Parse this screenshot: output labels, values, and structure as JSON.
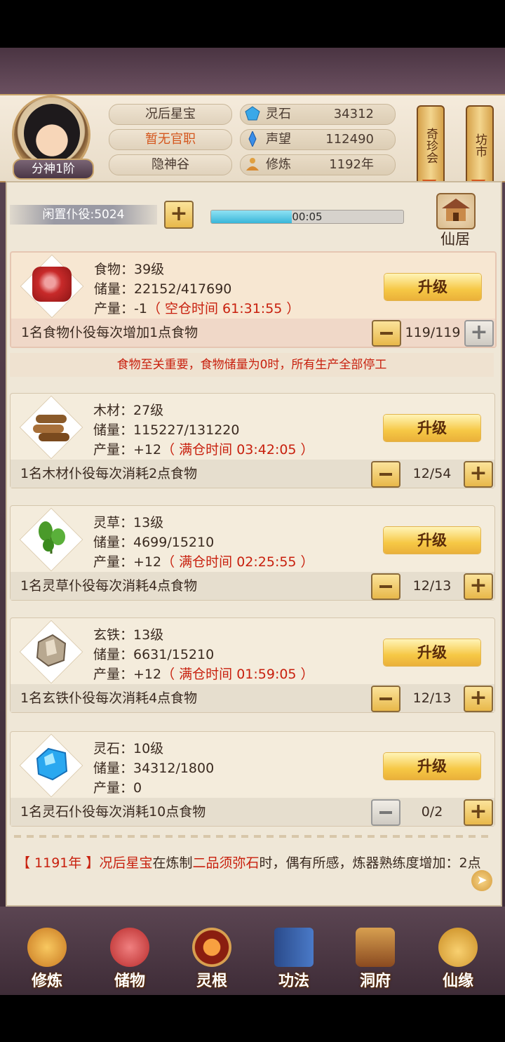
{
  "header": {
    "player_name": "况后星宝",
    "official_rank": "暂无官职",
    "location": "隐神谷",
    "realm_badge": "分神1阶",
    "resources": [
      {
        "icon": "spirit-stone-icon",
        "label": "灵石",
        "value": "34312"
      },
      {
        "icon": "reputation-icon",
        "label": "声望",
        "value": "112490"
      },
      {
        "icon": "cultivation-icon",
        "label": "修炼",
        "value": "1192年"
      }
    ],
    "scroll_buttons": [
      "奇珍会",
      "坊市"
    ]
  },
  "idle": {
    "label": "闲置仆役:5024",
    "timer": "00:05",
    "progress": 0.42
  },
  "xianju_label": "仙居",
  "items": [
    {
      "icon": "meat-icon",
      "name_line": "食物：39级",
      "storage_line": "储量：22152/417690",
      "output_prefix": "产量：-1",
      "output_note": "（ 空仓时间 61:31:55 ）",
      "upgrade": "升级",
      "rule": "1名食物仆役每次增加1点食物",
      "count": "119/119",
      "minus_enabled": true,
      "plus_enabled": false,
      "highlighted": true
    },
    {
      "icon": "wood-icon",
      "name_line": "木材：27级",
      "storage_line": "储量：115227/131220",
      "output_prefix": "产量：+12",
      "output_note": "（ 满仓时间 03:42:05 ）",
      "upgrade": "升级",
      "rule": "1名木材仆役每次消耗2点食物",
      "count": "12/54",
      "minus_enabled": true,
      "plus_enabled": true,
      "highlighted": false
    },
    {
      "icon": "herb-icon",
      "name_line": "灵草：13级",
      "storage_line": "储量：4699/15210",
      "output_prefix": "产量：+12",
      "output_note": "（ 满仓时间 02:25:55 ）",
      "upgrade": "升级",
      "rule": "1名灵草仆役每次消耗4点食物",
      "count": "12/13",
      "minus_enabled": true,
      "plus_enabled": true,
      "highlighted": false
    },
    {
      "icon": "iron-ore-icon",
      "name_line": "玄铁：13级",
      "storage_line": "储量：6631/15210",
      "output_prefix": "产量：+12",
      "output_note": "（ 满仓时间 01:59:05 ）",
      "upgrade": "升级",
      "rule": "1名玄铁仆役每次消耗4点食物",
      "count": "12/13",
      "minus_enabled": true,
      "plus_enabled": true,
      "highlighted": false
    },
    {
      "icon": "spirit-stone-icon",
      "name_line": "灵石：10级",
      "storage_line": "储量：34312/1800",
      "output_prefix": "产量：0",
      "output_note": "",
      "upgrade": "升级",
      "rule": "1名灵石仆役每次消耗10点食物",
      "count": "0/2",
      "minus_enabled": false,
      "plus_enabled": true,
      "highlighted": false
    }
  ],
  "warning": "食物至关重要，食物储量为0时，所有生产全部停工",
  "log": {
    "year": "【 1191年 】",
    "actor": "况后星宝",
    "mid1": "在炼制",
    "item": "二品须弥石",
    "mid2": "时，偶有所感，炼器熟练度增加：2点"
  },
  "nav": [
    {
      "label": "修炼",
      "icon": "monk-icon"
    },
    {
      "label": "储物",
      "icon": "bag-icon"
    },
    {
      "label": "灵根",
      "icon": "root-swirl-icon"
    },
    {
      "label": "功法",
      "icon": "book-icon"
    },
    {
      "label": "洞府",
      "icon": "palace-icon"
    },
    {
      "label": "仙缘",
      "icon": "gourd-icon"
    }
  ],
  "colors": {
    "accent_gold": "#f6c845",
    "alert_red": "#c8200e",
    "frame_purple": "#5b4552"
  }
}
